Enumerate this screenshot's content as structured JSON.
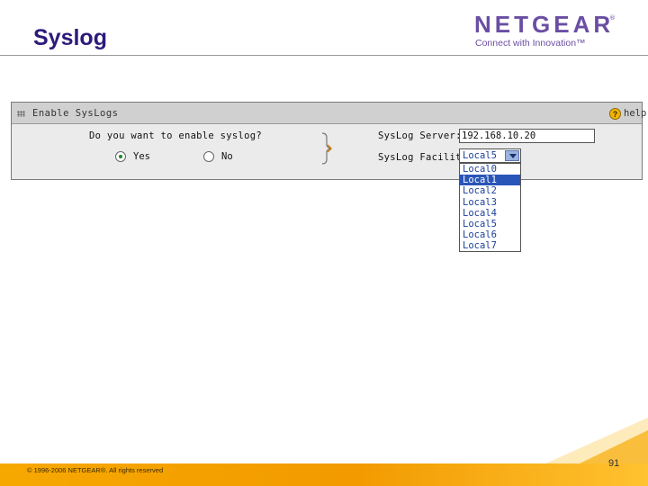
{
  "slide": {
    "title": "Syslog",
    "page_number": "91",
    "copyright": "© 1996-2006 NETGEAR®. All rights reserved"
  },
  "brand": {
    "name": "NETGEAR",
    "reg_mark": "®",
    "tagline": "Connect with Innovation™",
    "color": "#6a4ea3"
  },
  "panel": {
    "title": "Enable SysLogs",
    "help_label": "help",
    "question": "Do you want to enable syslog?",
    "options": [
      {
        "label": "Yes",
        "checked": true
      },
      {
        "label": "No",
        "checked": false
      }
    ],
    "server_label": "SysLog Server:",
    "server_value": "192.168.10.20",
    "facility_label": "SysLog Facility:",
    "facility_selected": "Local5",
    "facility_options": [
      "Local0",
      "Local1",
      "Local2",
      "Local3",
      "Local4",
      "Local5",
      "Local6",
      "Local7"
    ],
    "highlighted_option": "Local1"
  },
  "colors": {
    "title": "#2e1a7a",
    "footer": "#f7a800",
    "selection": "#2a55b8"
  }
}
